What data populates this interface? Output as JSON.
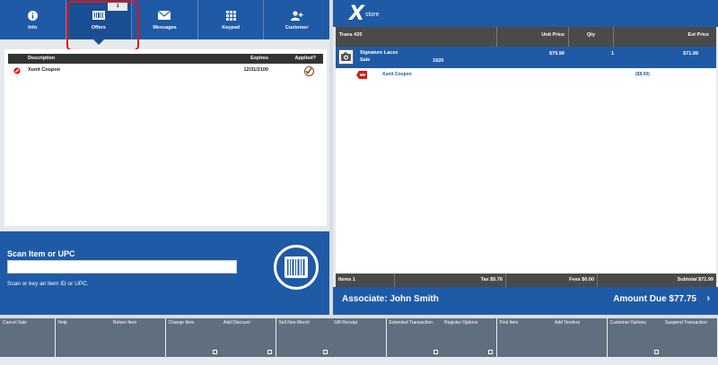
{
  "tabs": [
    {
      "key": "info",
      "label": "Info",
      "icon": "info-icon"
    },
    {
      "key": "offers",
      "label": "Offers",
      "icon": "barcode-icon",
      "badge": "1",
      "active": true
    },
    {
      "key": "messages",
      "label": "Messages",
      "icon": "envelope-icon"
    },
    {
      "key": "keypad",
      "label": "Keypad",
      "icon": "keypad-icon"
    },
    {
      "key": "customer",
      "label": "Customer",
      "icon": "add-user-icon"
    }
  ],
  "offers": {
    "headers": {
      "description": "Description",
      "expires": "Expires",
      "applied": "Applied?"
    },
    "rows": [
      {
        "description": "Xunit Coupon",
        "expires": "12/31/2100",
        "applied": true
      }
    ]
  },
  "scan": {
    "title": "Scan Item or UPC",
    "value": "",
    "hint": "Scan or key an item ID or UPC."
  },
  "logo": {
    "mark": "X",
    "text": "store"
  },
  "transaction": {
    "headers": {
      "trans": "Trans #20",
      "unit_price": "Unit Price",
      "qty": "Qty",
      "ext_price": "Ext Price"
    },
    "item": {
      "name": "Signature Laces",
      "sub": "Sale",
      "code": "1920",
      "unit_price": "$79.99",
      "qty": "1",
      "ext_price": "$71.99"
    },
    "coupon": {
      "name": "Xunit Coupon",
      "amount": "($8.00)"
    }
  },
  "totals": {
    "items": "Items 1",
    "tax": "Tax $5.76",
    "fees": "Fees $0.00",
    "subtotal": "Subtotal $71.99"
  },
  "associate": "Associate: John Smith",
  "amount_due": "Amount Due  $77.75",
  "function_buttons": [
    {
      "label": "Cancel Sale",
      "more": false
    },
    {
      "label": "Help",
      "more": false
    },
    {
      "label": "Return Item",
      "more": false
    },
    {
      "label": "Change Item",
      "more": true
    },
    {
      "label": "Add Discount",
      "more": true
    },
    {
      "label": "Sell Non-Merch",
      "more": true
    },
    {
      "label": "Gift Receipt",
      "more": false
    },
    {
      "label": "Extended Transaction",
      "more": true
    },
    {
      "label": "Register Options",
      "more": true
    },
    {
      "label": "Find Item",
      "more": false
    },
    {
      "label": "Add Tenders",
      "more": false
    },
    {
      "label": "Customer Options",
      "more": true
    },
    {
      "label": "Suspend Transaction",
      "more": false
    }
  ],
  "colors": {
    "primary": "#1f5aa6",
    "header_dark": "#4a4a4a",
    "function_btn": "#5f6f80",
    "highlight": "#e01616"
  }
}
